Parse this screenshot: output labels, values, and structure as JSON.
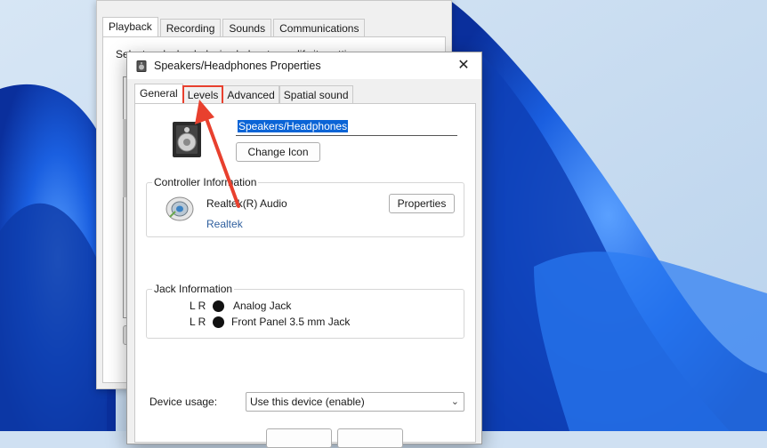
{
  "sound_dialog": {
    "tabs": [
      {
        "label": "Playback",
        "active": true
      },
      {
        "label": "Recording",
        "active": false
      },
      {
        "label": "Sounds",
        "active": false
      },
      {
        "label": "Communications",
        "active": false
      }
    ],
    "instruction": "Select a playback device below to modify its settings:"
  },
  "properties_dialog": {
    "title": "Speakers/Headphones Properties",
    "close_glyph": "✕",
    "tabs": [
      {
        "label": "General",
        "active": true
      },
      {
        "label": "Levels",
        "active": false,
        "highlighted": true
      },
      {
        "label": "Advanced",
        "active": false
      },
      {
        "label": "Spatial sound",
        "active": false
      }
    ],
    "device_name_value": "Speakers/Headphones",
    "change_icon_label": "Change Icon",
    "controller": {
      "legend": "Controller Information",
      "name": "Realtek(R) Audio",
      "link": "Realtek",
      "properties_label": "Properties"
    },
    "jack": {
      "legend": "Jack Information",
      "rows": [
        {
          "lr": "L R",
          "name": "Analog Jack"
        },
        {
          "lr": "L R",
          "name": "Front Panel 3.5 mm Jack"
        }
      ]
    },
    "device_usage": {
      "label": "Device usage:",
      "value": "Use this device (enable)"
    }
  },
  "annotation": {
    "arrow_color": "#e8402e",
    "highlight_color": "#e8402e"
  },
  "icons": [
    "speaker-device-icon",
    "audio-controller-icon",
    "close-icon",
    "chevron-down-icon",
    "title-speaker-icon"
  ]
}
